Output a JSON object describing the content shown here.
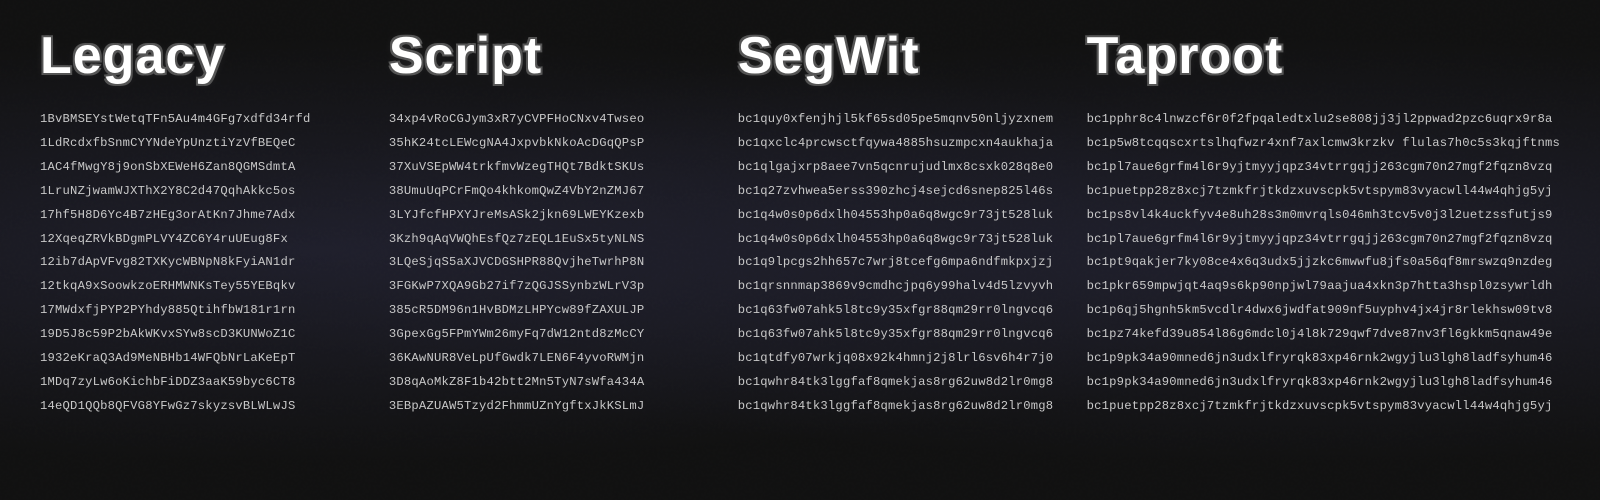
{
  "columns": [
    {
      "id": "legacy",
      "header": "Legacy",
      "addresses": [
        "1BvBMSEYstWetqTFn5Au4m4GFg7xdfd34rfd",
        "1LdRcdxfbSnmCYYNdeYpUnztiYzVfBEQeC",
        "1AC4fMwgY8j9onSbXEWeH6Zan8QGMSdmtA",
        "1LruNZjwamWJXThX2Y8C2d47QqhAkkc5os",
        "17hf5H8D6Yc4B7zHEg3orAtKn7Jhme7Adx",
        "12XqeqZRVkBDgmPLVY4ZC6Y4ruUEug8Fx",
        "12ib7dApVFvg82TXKycWBNpN8kFyiAN1dr",
        "12tkqA9xSoowkzoERHMWNKsTey55YEBqkv",
        "17MWdxfjPYP2PYhdy885QtihfbW181r1rn",
        "19D5J8c59P2bAkWKvxSYw8scD3KUNWoZ1C",
        "1932eKraQ3Ad9MeNBHb14WFQbNrLaKeEpT",
        "1MDq7zyLw6oKichbFiDDZ3aaK59byc6CT8",
        "14eQD1QQb8QFVG8YFwGz7skyzsvBLWLwJS"
      ]
    },
    {
      "id": "script",
      "header": "Script",
      "addresses": [
        "34xp4vRoCGJym3xR7yCVPFHoCNxv4Twseo",
        "35hK24tcLEWcgNA4JxpvbkNkoAcDGqQPsP",
        "37XuVSEpWW4trkfmvWzegTHQt7BdktSKUs",
        "38UmuUqPCrFmQo4khkomQwZ4VbY2nZMJ67",
        "3LYJfcfHPXYJreMsASk2jkn69LWEYKzexb",
        "3Kzh9qAqVWQhEsfQz7zEQL1EuSx5tyNLNS",
        "3LQeSjqS5aXJVCDGSHPR88QvjheTwrhP8N",
        "3FGKwP7XQA9Gb27if7zQGJSSynbzWLrV3p",
        "385cR5DM96n1HvBDMzLHPYcw89fZAXULJP",
        "3GpexGg5FPmYWm26myFq7dW12ntd8zMcCY",
        "36KAwNUR8VeLpUfGwdk7LEN6F4yvoRWMjn",
        "3D8qAoMkZ8F1b42btt2Mn5TyN7sWfa434A",
        "3EBpAZUAW5Tzyd2FhmmUZnYgftxJkKSLmJ"
      ]
    },
    {
      "id": "segwit",
      "header": "SegWit",
      "addresses": [
        "bc1quy0xfenjhjl5kf65sd05pe5mqnv50nljyzxnem",
        "bc1qxclc4prcwsctfqywa4885hsuzmpcxn4aukhaja",
        "bc1qlgajxrp8aee7vn5qcnrujudlmx8csxk028q8e0",
        "bc1q27zvhwea5erss390zhcj4sejcd6snep825l46s",
        "bc1q4w0s0p6dxlh04553hp0a6q8wgc9r73jt528luk",
        "bc1q4w0s0p6dxlh04553hp0a6q8wgc9r73jt528luk",
        "bc1q9lpcgs2hh657c7wrj8tcefg6mpa6ndfmkpxjzj",
        "bc1qrsnnmap3869v9cmdhcjpq6y99halv4d5lzvyvh",
        "bc1q63fw07ahk5l8tc9y35xfgr88qm29rr0lngvcq6",
        "bc1q63fw07ahk5l8tc9y35xfgr88qm29rr0lngvcq6",
        "bc1qtdfy07wrkjq08x92k4hmnj2j8lrl6sv6h4r7j0",
        "bc1qwhr84tk3lggfaf8qmekjas8rg62uw8d2lr0mg8",
        "bc1qwhr84tk3lggfaf8qmekjas8rg62uw8d2lr0mg8"
      ]
    },
    {
      "id": "taproot",
      "header": "Taproot",
      "addresses": [
        "bc1pphr8c4lnwzcf6r0f2fpqaledtxlu2se808jj3jl2ppwad2pzc6uqrx9r8a",
        "bc1p5w8tcqqscxrtslhqfwzr4xnf7axlcmw3krzkv flulas7h0c5s3kqjftnms",
        "bc1pl7aue6grfm4l6r9yjtmyyjqpz34vtrrgqjj263cgm70n27mgf2fqzn8vzq",
        "bc1puetpp28z8xcj7tzmkfrjtkdzxuvscpk5vtspym83vyacwll44w4qhjg5yj",
        "bc1ps8vl4k4uckfyv4e8uh28s3m0mvrqls046mh3tcv5v0j3l2uetzssfutjs9",
        "bc1pl7aue6grfm4l6r9yjtmyyjqpz34vtrrgqjj263cgm70n27mgf2fqzn8vzq",
        "bc1pt9qakjer7ky08ce4x6q3udx5jjzkc6mwwfu8jfs0a56qf8mrswzq9nzdeg",
        "bc1pkr659mpwjqt4aq9s6kp90npjwl79aajua4xkn3p7htta3hspl0zsywrldh",
        "bc1p6qj5hgnh5km5vcdlr4dwx6jwdfat909nf5uyphv4jx4jr8rlekhsw09tv8",
        "bc1pz74kefd39u854l86g6mdcl0j4l8k729qwf7dve87nv3fl6gkkm5qnaw49e",
        "bc1p9pk34a90mned6jn3udxlfryrqk83xp46rnk2wgyjlu3lgh8ladfsyhum46",
        "bc1p9pk34a90mned6jn3udxlfryrqk83xp46rnk2wgyjlu3lgh8ladfsyhum46",
        "bc1puetpp28z8xcj7tzmkfrjtkdzxuvscpk5vtspym83vyacwll44w4qhjg5yj"
      ]
    }
  ]
}
